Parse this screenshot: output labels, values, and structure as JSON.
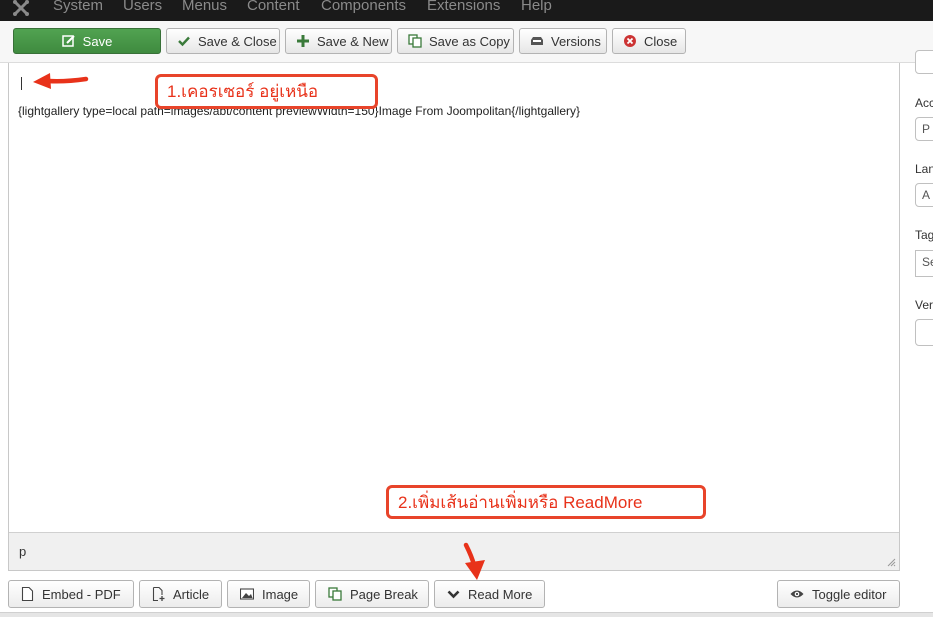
{
  "topnav": {
    "menus": [
      "System",
      "Users",
      "Menus",
      "Content",
      "Components",
      "Extensions",
      "Help"
    ]
  },
  "toolbar": {
    "save_label": "Save",
    "save_close_label": "Save & Close",
    "save_new_label": "Save & New",
    "save_copy_label": "Save as Copy",
    "versions_label": "Versions",
    "close_label": "Close"
  },
  "editor": {
    "content": "{lightgallery type=local path=images/abt/content previewWidth=150}Image From Joompolitan{/lightgallery}",
    "path": "p"
  },
  "editor_buttons": {
    "embed_pdf": "Embed - PDF",
    "article": "Article",
    "image": "Image",
    "page_break": "Page Break",
    "read_more": "Read More",
    "toggle_editor": "Toggle editor"
  },
  "sidebar": {
    "labels": [
      "Acc",
      "Lan",
      "Tag",
      "Ver"
    ],
    "values": [
      "P",
      "A",
      "Se",
      ""
    ]
  },
  "annotations": {
    "callout_1": "1.เคอรเซอร์ อยู่เหนือ",
    "callout_2": "2.เพิ่มเส้นอ่านเพิ่มหรือ ReadMore"
  },
  "colors": {
    "save_green": "#46a546",
    "annotation_red": "#e8321a",
    "topbar": "#1a1a1a"
  }
}
